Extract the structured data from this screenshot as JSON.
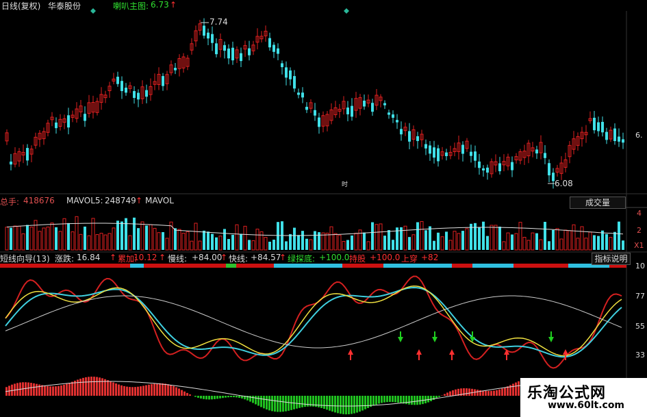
{
  "header": {
    "period_label": "日线(复权)",
    "stock_name": "华泰股份",
    "main_indicator": "喇叭主图:",
    "main_indicator_value": "6.73",
    "up_arrow": "↑"
  },
  "price_panel": {
    "high_label": "7.74",
    "low_label": "6.08",
    "right_axis_label": "6.",
    "center_marker": "时"
  },
  "volume_panel": {
    "total_hands_label": "总手:",
    "total_hands_value": "418676",
    "mavol5_label": "MAVOL5:",
    "mavol5_value": "248749",
    "mavol_label": "MAVOL",
    "button_label": "成交量",
    "axis_labels": [
      "4",
      "2",
      "X1"
    ]
  },
  "indicator_panel": {
    "name": "短线向导(13)",
    "change_label": "涨跌:",
    "change_value": "16.84",
    "accum_label": "累加:",
    "accum_value": "10.12",
    "slow_label": "慢线:",
    "slow_value": "+84.00",
    "fast_label": "快线:",
    "fast_value": "+84.57",
    "green_bottom_label": "绿探底:",
    "green_bottom_value": "+100.0",
    "hold_label": "持股",
    "hold_value": "+100.0",
    "cross_label": "上穿",
    "cross_value": "+82",
    "button_label": "指标说明",
    "axis_labels": [
      "10",
      "77",
      "55",
      "33"
    ]
  },
  "watermark": {
    "title": "乐淘公式网",
    "url": "www.60lt.com"
  },
  "colors": {
    "up": "#e02020",
    "down": "#40e0e8",
    "yellow": "#f0e040",
    "white": "#e0e0e0",
    "green": "#20d020",
    "accent_red": "#ff3030"
  }
}
